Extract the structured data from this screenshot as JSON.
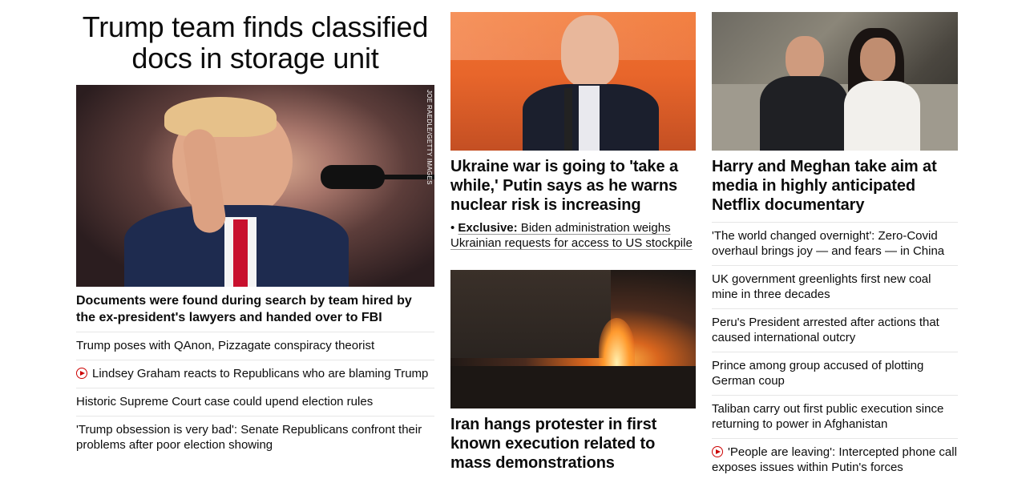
{
  "lead": {
    "headline": "Trump team finds classified docs in storage unit",
    "image_credit": "JOE RAEDLE/GETTY IMAGES",
    "summary": "Documents were found during search by team hired by the ex-president's lawyers and handed over to FBI",
    "related": [
      {
        "text": "Trump poses with QAnon, Pizzagate conspiracy theorist",
        "video": false
      },
      {
        "text": "Lindsey Graham reacts to Republicans who are blaming Trump",
        "video": true
      },
      {
        "text": "Historic Supreme Court case could upend election rules",
        "video": false
      },
      {
        "text": "'Trump obsession is very bad': Senate Republicans confront their problems after poor election showing",
        "video": false
      }
    ]
  },
  "putin": {
    "headline": "Ukraine war is going to 'take a while,' Putin says as he warns nuclear risk is increasing",
    "sub_prefix": "• ",
    "sub_label": "Exclusive:",
    "sub_text": " Biden administration weighs Ukrainian requests for access to US stockpile"
  },
  "iran": {
    "headline": "Iran hangs protester in first known execution related to mass demonstrations"
  },
  "harry": {
    "headline": "Harry and Meghan take aim at media in highly anticipated Netflix documentary",
    "list": [
      {
        "text": "'The world changed overnight': Zero-Covid overhaul brings joy — and fears — in China",
        "video": false
      },
      {
        "text": "UK government greenlights first new coal mine in three decades",
        "video": false
      },
      {
        "text": "Peru's President arrested after actions that caused international outcry",
        "video": false
      },
      {
        "text": "Prince among group accused of plotting German coup",
        "video": false
      },
      {
        "text": "Taliban carry out first public execution since returning to power in Afghanistan",
        "video": false
      },
      {
        "text": "'People are leaving': Intercepted phone call exposes issues within Putin's forces",
        "video": true
      }
    ]
  },
  "colors": {
    "video_red": "#cc0000",
    "divider": "#e6e6e6",
    "text": "#0c0c0c"
  }
}
